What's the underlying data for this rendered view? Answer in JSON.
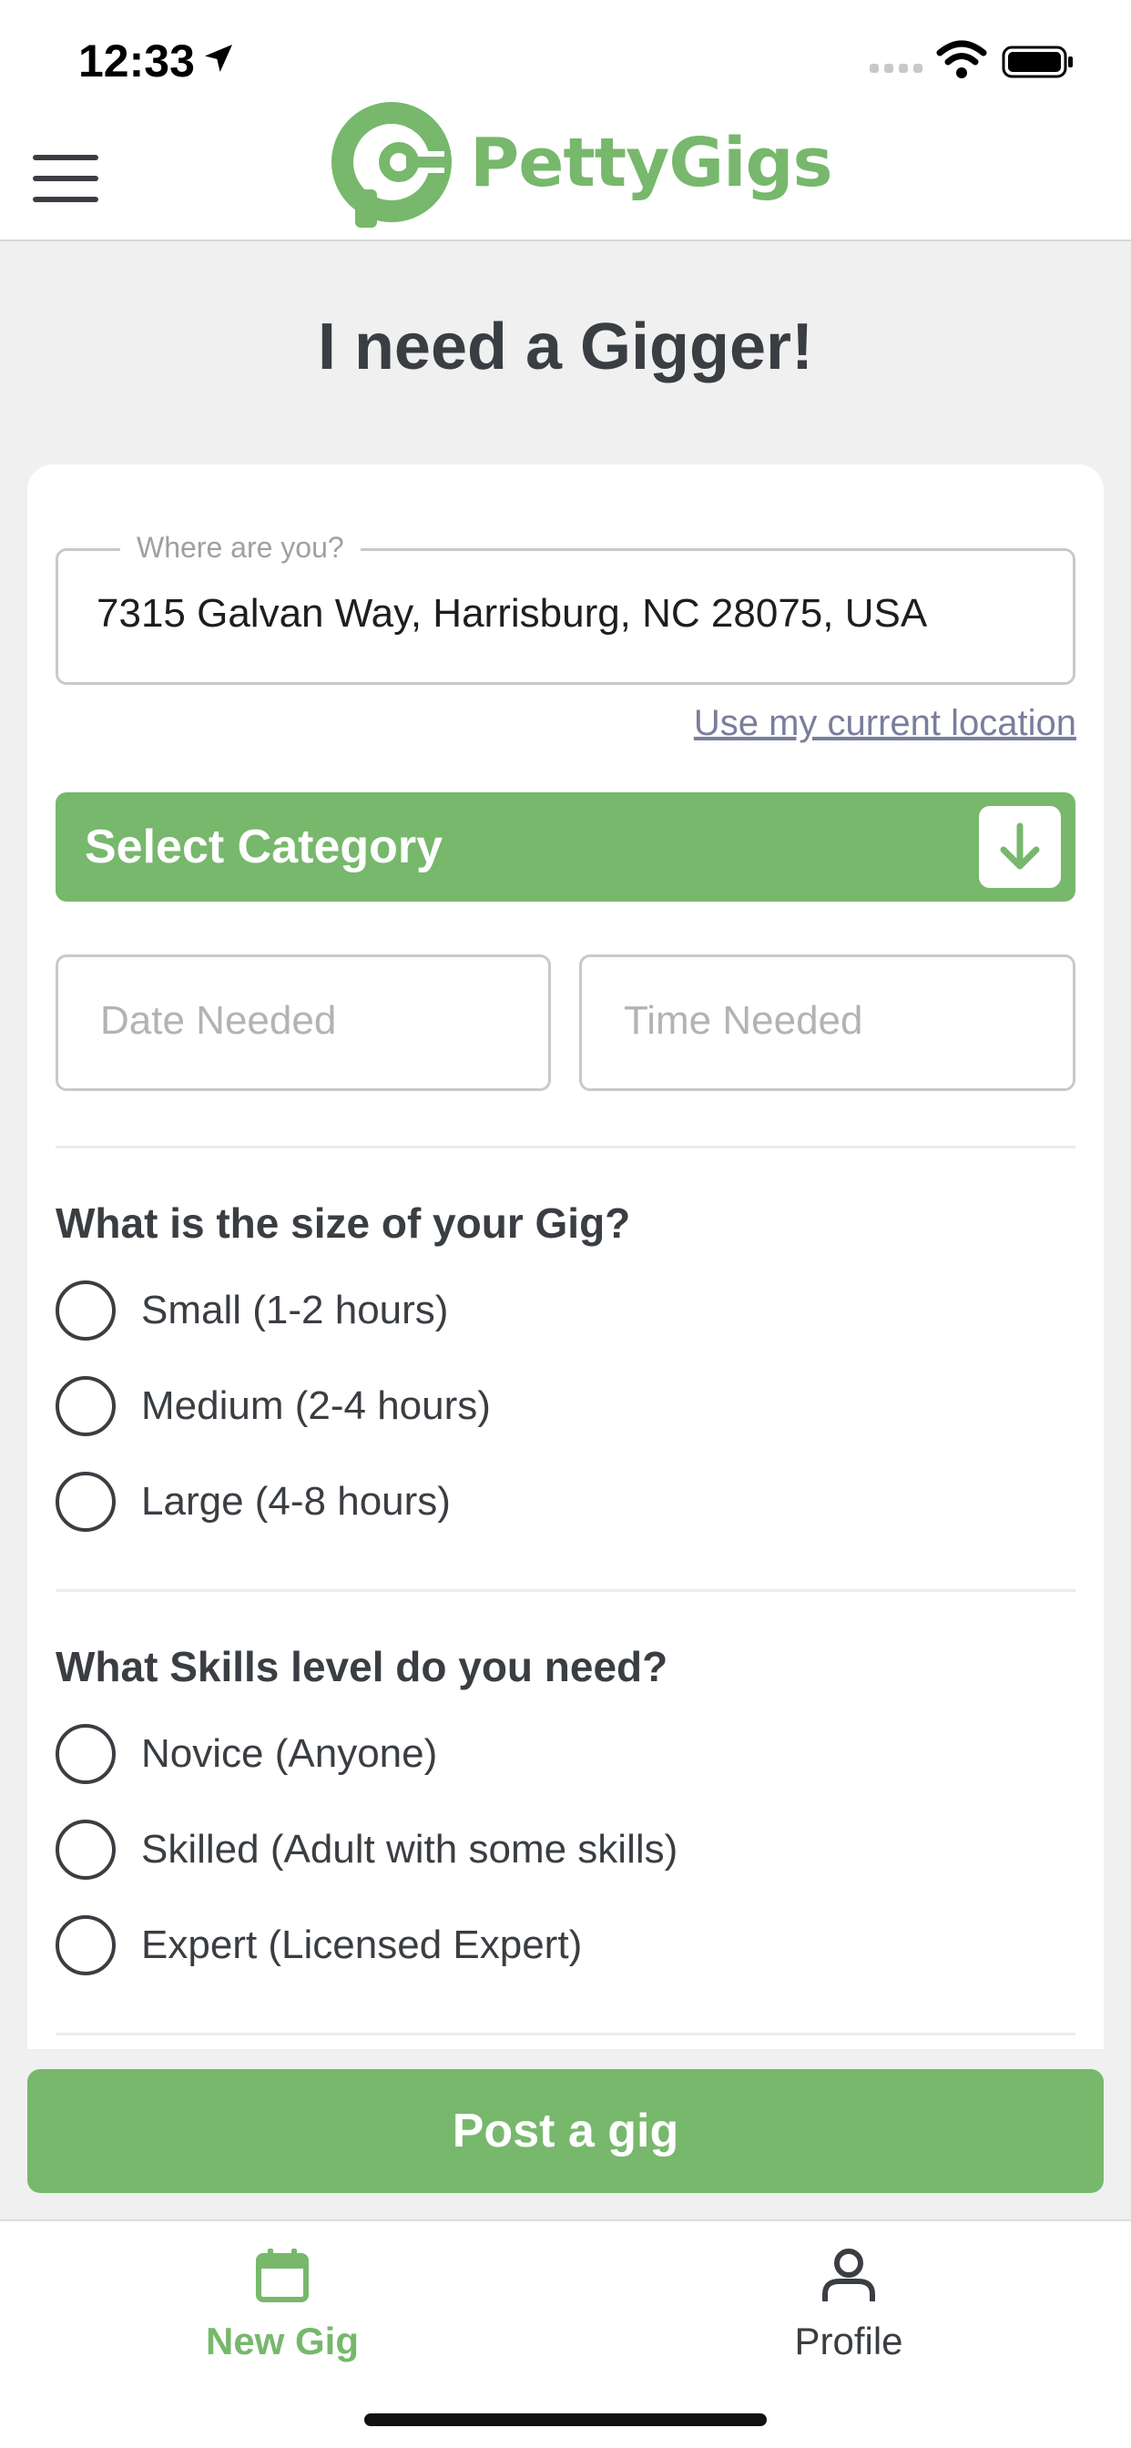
{
  "status_bar": {
    "time": "12:33"
  },
  "header": {
    "logo_text": "PettyGigs"
  },
  "page": {
    "title": "I need a Gigger!"
  },
  "form": {
    "location_label": "Where are you?",
    "location_value": "7315 Galvan Way, Harrisburg, NC 28075, USA",
    "use_location_link": "Use my current location",
    "category_button": "Select Category",
    "date_placeholder": "Date Needed",
    "time_placeholder": "Time Needed",
    "size_question": "What is the size of your Gig?",
    "size_options": [
      "Small (1-2 hours)",
      "Medium (2-4 hours)",
      "Large (4-8 hours)"
    ],
    "skills_question": "What Skills level do you need?",
    "skills_options": [
      "Novice (Anyone)",
      "Skilled (Adult with some skills)",
      "Expert (Licensed Expert)"
    ]
  },
  "actions": {
    "post_button": "Post a gig"
  },
  "tabbar": {
    "items": [
      {
        "label": "New Gig",
        "icon": "calendar-icon",
        "active": true
      },
      {
        "label": "Profile",
        "icon": "person-icon",
        "active": false
      }
    ]
  },
  "colors": {
    "accent": "#77b86c",
    "text": "#3a3e42",
    "link": "#7a7e9c"
  }
}
